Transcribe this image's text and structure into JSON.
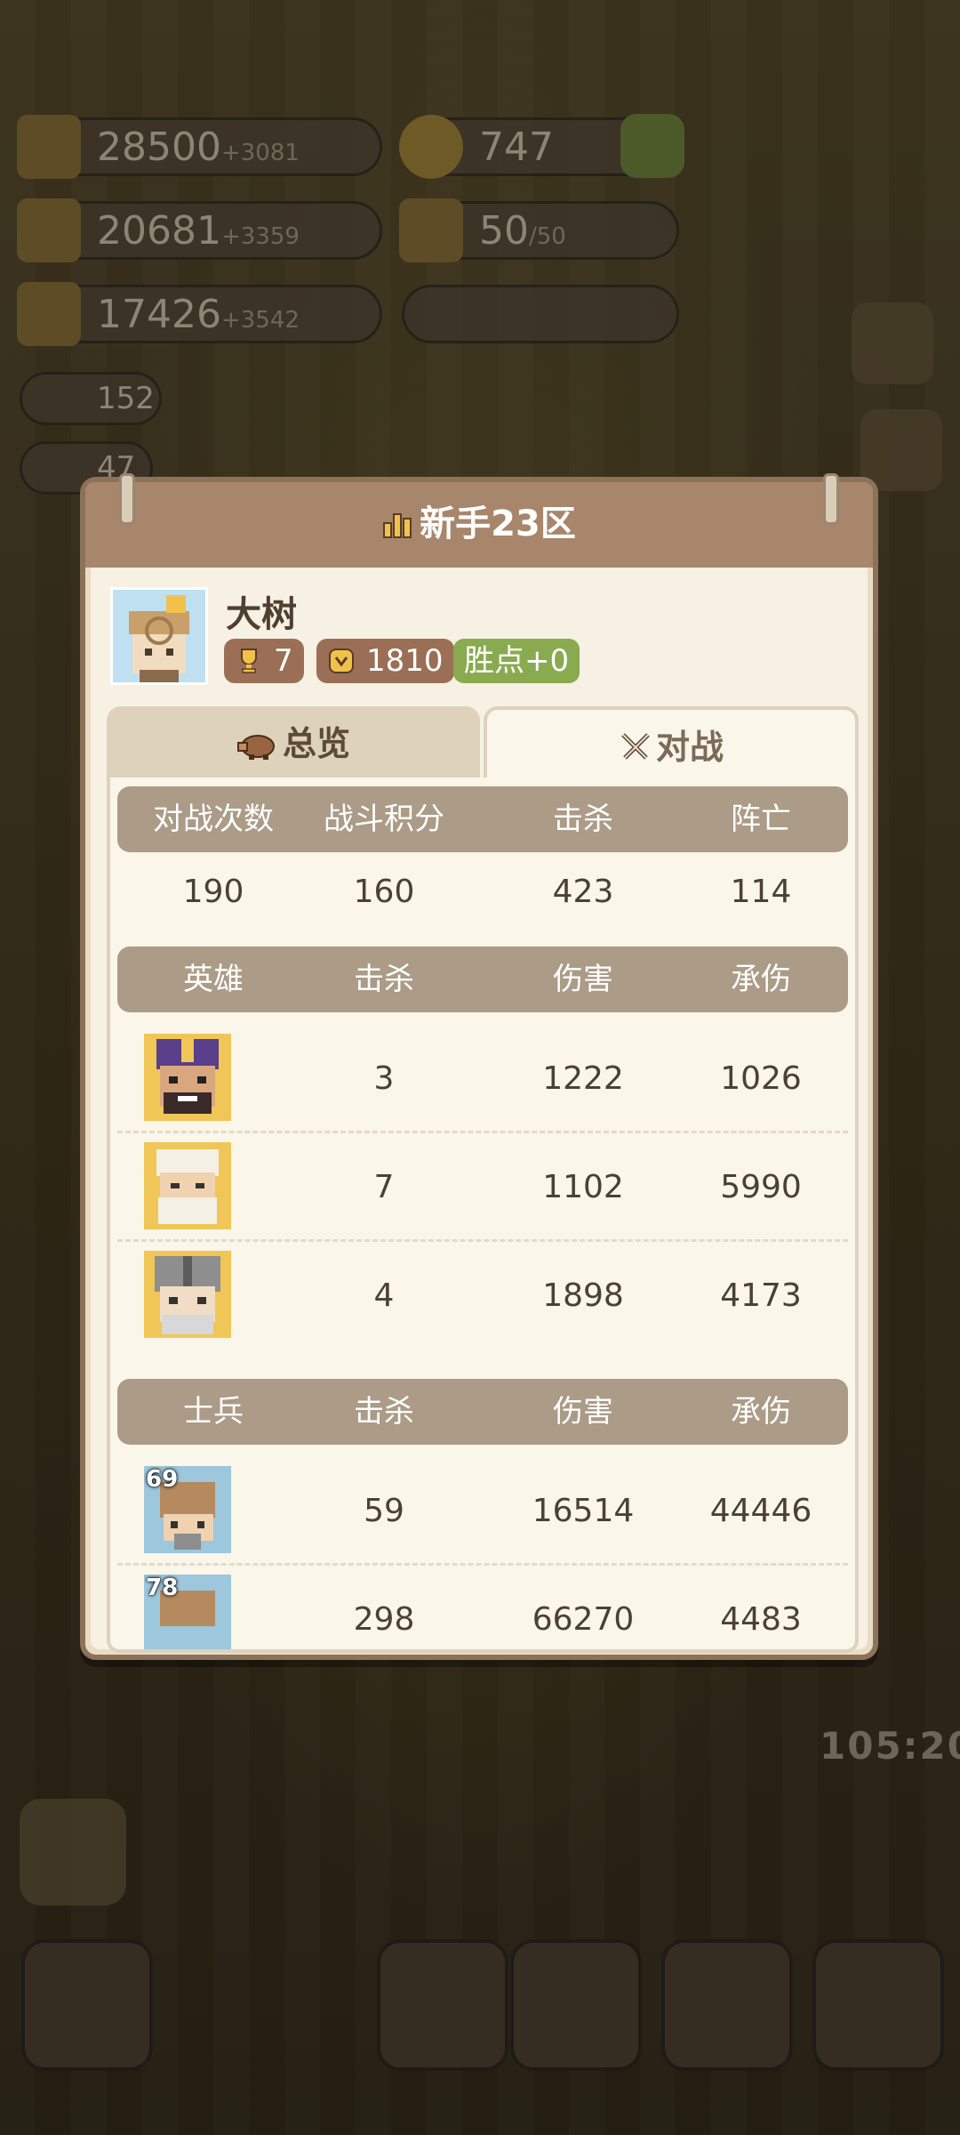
{
  "background": {
    "resources": [
      {
        "value": "28500",
        "plus": "+3081"
      },
      {
        "value": "20681",
        "plus": "+3359"
      },
      {
        "value": "17426",
        "plus": "+3542"
      }
    ],
    "coins": "747",
    "capacity": {
      "value": "50",
      "max": "/50"
    },
    "small_counts": [
      "152",
      "47"
    ],
    "timer": "105:20"
  },
  "dialog": {
    "title": "新手23区",
    "player": {
      "name": "大树",
      "trophies": "7",
      "rating": "1810",
      "victory_points": "胜点+0"
    },
    "tabs": [
      {
        "label": "总览",
        "active": false
      },
      {
        "label": "对战",
        "active": true
      }
    ],
    "summary": {
      "headers": [
        "对战次数",
        "战斗积分",
        "击杀",
        "阵亡"
      ],
      "values": [
        "190",
        "160",
        "423",
        "114"
      ]
    },
    "heroes": {
      "headers": [
        "英雄",
        "击杀",
        "伤害",
        "承伤"
      ],
      "rows": [
        {
          "kills": "3",
          "damage": "1222",
          "taken": "1026"
        },
        {
          "kills": "7",
          "damage": "1102",
          "taken": "5990"
        },
        {
          "kills": "4",
          "damage": "1898",
          "taken": "4173"
        }
      ]
    },
    "soldiers": {
      "headers": [
        "士兵",
        "击杀",
        "伤害",
        "承伤"
      ],
      "rows": [
        {
          "level": "69",
          "kills": "59",
          "damage": "16514",
          "taken": "44446"
        },
        {
          "level": "78",
          "kills": "298",
          "damage": "66270",
          "taken": "4483"
        }
      ]
    }
  },
  "colors": {
    "header": "#a8866c",
    "chip_brown": "#9a6f56",
    "chip_green": "#8aaa50"
  }
}
